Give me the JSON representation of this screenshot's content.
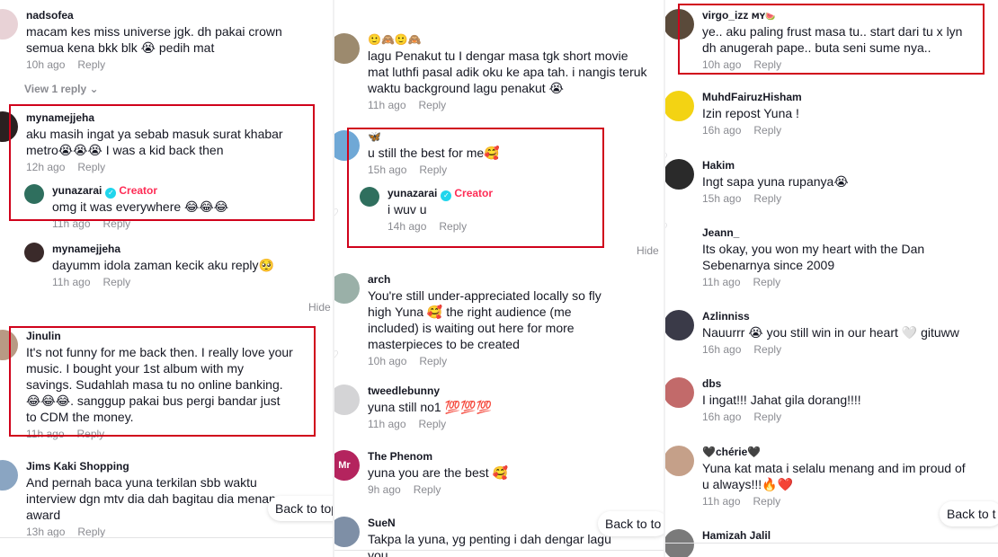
{
  "colors": {
    "highlight": "#d0021b",
    "creator": "#fe2c55",
    "verified": "#20d5ec",
    "meta": "#8a8b91"
  },
  "common": {
    "reply": "Reply",
    "creator_label": "Creator",
    "hide": "Hide",
    "back_to_top": "Back to top",
    "back_to_top_cut": "Back to to",
    "back_to_top_cut2": "Back to t"
  },
  "panel1": {
    "view_replies": "View 1 reply",
    "comments": [
      {
        "user": "nadsofea",
        "text": "macam kes miss universe jgk. dh pakai crown semua kena bkk blk 😭 pedih mat",
        "time": "10h ago"
      },
      {
        "user": "mynamejjeha",
        "text": "aku masih ingat ya sebab masuk surat khabar metro😭😭😭 I was a kid back then",
        "time": "12h ago"
      },
      {
        "user": "yunazarai",
        "text": "omg it was everywhere 😂😂😂",
        "time": "11h ago"
      },
      {
        "user": "mynamejjeha",
        "text": "dayumm idola zaman kecik aku reply🥺",
        "time": "11h ago"
      },
      {
        "user": "Jinulin",
        "text": "It's not funny for me back then. I really love your music. I bought your 1st album with my savings. Sudahlah masa tu no online banking. 😂😂😂. sanggup pakai bus pergi bandar just to CDM the money.",
        "time": "11h ago"
      },
      {
        "user": "Jims Kaki Shopping",
        "text": "And pernah baca yuna terkilan sbb waktu interview dgn mtv dia dah bagitau dia menang award",
        "time": "13h ago"
      }
    ]
  },
  "panel2": {
    "comments": [
      {
        "user": "🙂🙈🙂🙈",
        "text": "lagu Penakut tu I dengar masa tgk short movie mat luthfi pasal adik oku ke apa tah. i nangis teruk waktu background lagu penakut 😭",
        "time": "11h ago"
      },
      {
        "user": "🦋",
        "text": "u still the best for me🥰",
        "time": "15h ago"
      },
      {
        "user": "yunazarai",
        "text": "i wuv u",
        "time": "14h ago"
      },
      {
        "user": "arch",
        "text": "You're still under-appreciated locally so fly high Yuna 🥰 the right audience (me included) is waiting out here for more masterpieces to be created",
        "time": "10h ago"
      },
      {
        "user": "tweedlebunny",
        "text": "yuna still no1 💯💯💯",
        "time": "11h ago"
      },
      {
        "user": "The Phenom",
        "text": "yuna you are the best 🥰",
        "time": "9h ago"
      },
      {
        "user": "SueN",
        "text": "Takpa la yuna, yg penting i dah dengar lagu you",
        "time": ""
      }
    ]
  },
  "panel3": {
    "comments": [
      {
        "user": "virgo_izz",
        "badge": "MY🍉",
        "text": "ye.. aku paling frust masa tu.. start dari tu x lyn dh anugerah pape.. buta seni sume nya..",
        "time": "10h ago"
      },
      {
        "user": "MuhdFairuzHisham",
        "text": "Izin repost Yuna !",
        "time": "16h ago"
      },
      {
        "user": "Hakim",
        "text": "Ingt sapa yuna rupanya😭",
        "time": "15h ago"
      },
      {
        "user": "Jeann_",
        "text": "Its okay, you won my heart with the Dan Sebenarnya since 2009",
        "time": "11h ago"
      },
      {
        "user": "Azlinniss",
        "text": "Nauurrr 😭 you still win in our heart 🤍 gituww",
        "time": "16h ago"
      },
      {
        "user": "dbs",
        "text": "I ingat!!! Jahat gila dorang!!!!",
        "time": "16h ago"
      },
      {
        "user": "🖤chérie🖤",
        "text": "Yuna kat mata i selalu menang and im proud of u always!!!🔥❤️",
        "time": "11h ago"
      },
      {
        "user": "Hamizah Jalil",
        "text": "",
        "time": ""
      }
    ]
  }
}
